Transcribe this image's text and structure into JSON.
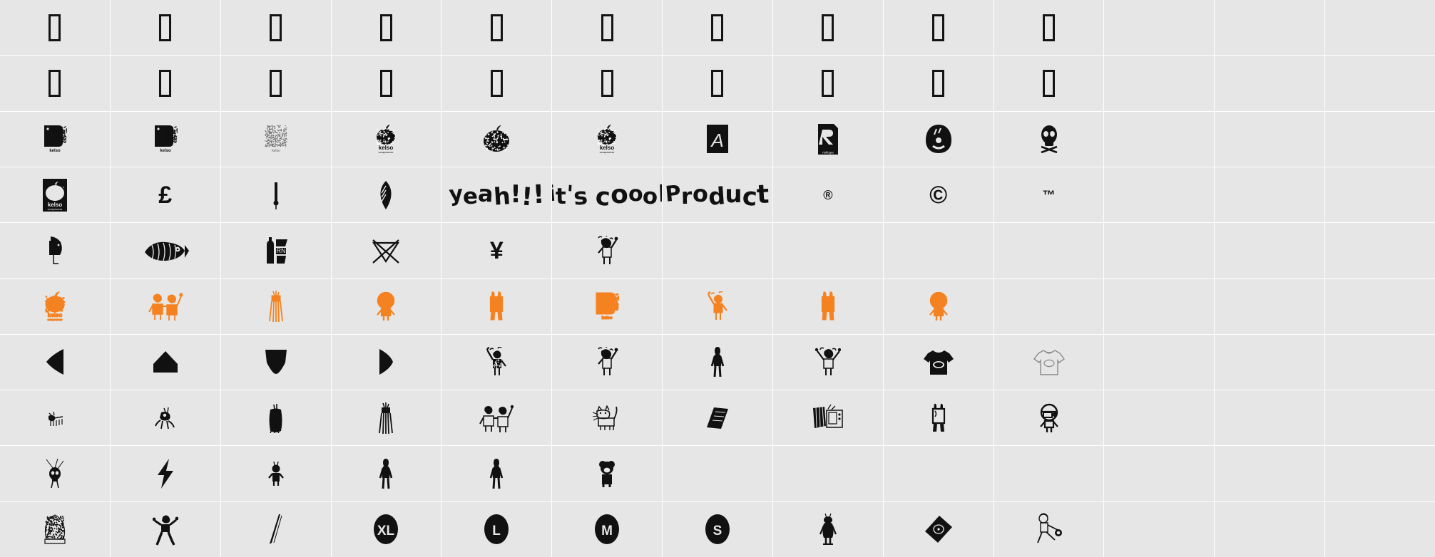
{
  "view": {
    "type": "font-character-map",
    "background_color": "#e6e6e6",
    "gridline_color": "#ffffff",
    "ink_color": "#111111",
    "accent_color": "#F58220",
    "columns": 13,
    "rows": 10
  },
  "cells": [
    {
      "r": 1,
      "c": 1,
      "name": "notdef-box",
      "kind": "notdef",
      "label": ""
    },
    {
      "r": 1,
      "c": 2,
      "name": "notdef-box",
      "kind": "notdef",
      "label": ""
    },
    {
      "r": 1,
      "c": 3,
      "name": "notdef-box",
      "kind": "notdef",
      "label": ""
    },
    {
      "r": 1,
      "c": 4,
      "name": "notdef-box",
      "kind": "notdef",
      "label": ""
    },
    {
      "r": 1,
      "c": 5,
      "name": "notdef-box",
      "kind": "notdef",
      "label": ""
    },
    {
      "r": 1,
      "c": 6,
      "name": "notdef-box",
      "kind": "notdef",
      "label": ""
    },
    {
      "r": 1,
      "c": 7,
      "name": "notdef-box",
      "kind": "notdef",
      "label": ""
    },
    {
      "r": 1,
      "c": 8,
      "name": "notdef-box",
      "kind": "notdef",
      "label": ""
    },
    {
      "r": 1,
      "c": 9,
      "name": "notdef-box",
      "kind": "notdef",
      "label": ""
    },
    {
      "r": 1,
      "c": 10,
      "name": "notdef-box",
      "kind": "notdef",
      "label": ""
    },
    {
      "r": 1,
      "c": 11,
      "name": "empty-cell",
      "kind": "empty",
      "label": ""
    },
    {
      "r": 1,
      "c": 12,
      "name": "empty-cell",
      "kind": "empty",
      "label": ""
    },
    {
      "r": 1,
      "c": 13,
      "name": "empty-cell",
      "kind": "empty",
      "label": ""
    },
    {
      "r": 2,
      "c": 1,
      "name": "notdef-box",
      "kind": "notdef",
      "label": ""
    },
    {
      "r": 2,
      "c": 2,
      "name": "notdef-box",
      "kind": "notdef",
      "label": ""
    },
    {
      "r": 2,
      "c": 3,
      "name": "notdef-box",
      "kind": "notdef",
      "label": ""
    },
    {
      "r": 2,
      "c": 4,
      "name": "notdef-box",
      "kind": "notdef",
      "label": ""
    },
    {
      "r": 2,
      "c": 5,
      "name": "notdef-box",
      "kind": "notdef",
      "label": ""
    },
    {
      "r": 2,
      "c": 6,
      "name": "notdef-box",
      "kind": "notdef",
      "label": ""
    },
    {
      "r": 2,
      "c": 7,
      "name": "notdef-box",
      "kind": "notdef",
      "label": ""
    },
    {
      "r": 2,
      "c": 8,
      "name": "notdef-box",
      "kind": "notdef",
      "label": ""
    },
    {
      "r": 2,
      "c": 9,
      "name": "notdef-box",
      "kind": "notdef",
      "label": ""
    },
    {
      "r": 2,
      "c": 10,
      "name": "notdef-box",
      "kind": "notdef",
      "label": ""
    },
    {
      "r": 2,
      "c": 11,
      "name": "empty-cell",
      "kind": "empty",
      "label": ""
    },
    {
      "r": 2,
      "c": 12,
      "name": "empty-cell",
      "kind": "empty",
      "label": ""
    },
    {
      "r": 2,
      "c": 13,
      "name": "empty-cell",
      "kind": "empty",
      "label": ""
    },
    {
      "r": 3,
      "c": 1,
      "name": "kelso-tag-logo-glyph",
      "kind": "kelso_tag",
      "label": "kelso"
    },
    {
      "r": 3,
      "c": 2,
      "name": "kelso-tag-logo-glyph",
      "kind": "kelso_tag",
      "label": "kelso"
    },
    {
      "r": 3,
      "c": 3,
      "name": "kelso-tag-outline-glyph",
      "kind": "kelso_tag_light",
      "label": "kelso"
    },
    {
      "r": 3,
      "c": 4,
      "name": "apple-wordmark-glyph",
      "kind": "apple_word",
      "label": "kelso"
    },
    {
      "r": 3,
      "c": 5,
      "name": "apple-solid-glyph",
      "kind": "apple_solid",
      "label": ""
    },
    {
      "r": 3,
      "c": 6,
      "name": "apple-wordmark-glyph",
      "kind": "apple_word",
      "label": "kelso"
    },
    {
      "r": 3,
      "c": 7,
      "name": "letter-a-box-glyph",
      "kind": "a_box",
      "label": "A"
    },
    {
      "r": 3,
      "c": 8,
      "name": "risktype-r-logo-glyph",
      "kind": "r_box",
      "label": "risktype"
    },
    {
      "r": 3,
      "c": 9,
      "name": "blob-face-glyph",
      "kind": "blob_face",
      "label": ""
    },
    {
      "r": 3,
      "c": 10,
      "name": "skull-crossbones-glyph",
      "kind": "skull",
      "label": ""
    },
    {
      "r": 3,
      "c": 11,
      "name": "empty-cell",
      "kind": "empty",
      "label": ""
    },
    {
      "r": 3,
      "c": 12,
      "name": "empty-cell",
      "kind": "empty",
      "label": ""
    },
    {
      "r": 3,
      "c": 13,
      "name": "empty-cell",
      "kind": "empty",
      "label": ""
    },
    {
      "r": 4,
      "c": 1,
      "name": "apple-label-box-glyph",
      "kind": "apple_label_box",
      "label": "kelso"
    },
    {
      "r": 4,
      "c": 2,
      "name": "pound-sign-glyph",
      "kind": "text_glyph",
      "label": "£"
    },
    {
      "r": 4,
      "c": 3,
      "name": "thin-figure-glyph",
      "kind": "thin_fig",
      "label": ""
    },
    {
      "r": 4,
      "c": 4,
      "name": "leaf-shell-glyph",
      "kind": "leaf",
      "label": ""
    },
    {
      "r": 4,
      "c": 5,
      "name": "yeah-lettering-glyph",
      "kind": "hand_text",
      "label": "yeah!!!"
    },
    {
      "r": 4,
      "c": 6,
      "name": "its-coool-lettering-glyph",
      "kind": "hand_text",
      "label": "it's coool"
    },
    {
      "r": 4,
      "c": 7,
      "name": "product-lettering-glyph",
      "kind": "hand_text",
      "label": "Product"
    },
    {
      "r": 4,
      "c": 8,
      "name": "registered-sign-glyph",
      "kind": "text_glyph_sm",
      "label": "®"
    },
    {
      "r": 4,
      "c": 9,
      "name": "copyright-sign-glyph",
      "kind": "text_glyph",
      "label": "©"
    },
    {
      "r": 4,
      "c": 10,
      "name": "trademark-sign-glyph",
      "kind": "text_glyph_sm",
      "label": "™"
    },
    {
      "r": 4,
      "c": 11,
      "name": "empty-cell",
      "kind": "empty",
      "label": ""
    },
    {
      "r": 4,
      "c": 12,
      "name": "empty-cell",
      "kind": "empty",
      "label": ""
    },
    {
      "r": 4,
      "c": 13,
      "name": "empty-cell",
      "kind": "empty",
      "label": ""
    },
    {
      "r": 5,
      "c": 1,
      "name": "bird-figure-glyph",
      "kind": "bird",
      "label": ""
    },
    {
      "r": 5,
      "c": 2,
      "name": "fish-glyph",
      "kind": "fish",
      "label": ""
    },
    {
      "r": 5,
      "c": 3,
      "name": "bottle-born-glyph",
      "kind": "born",
      "label": ""
    },
    {
      "r": 5,
      "c": 4,
      "name": "no-bleach-symbol-glyph",
      "kind": "nobleach",
      "label": ""
    },
    {
      "r": 5,
      "c": 5,
      "name": "yen-sign-glyph",
      "kind": "text_glyph",
      "label": "¥"
    },
    {
      "r": 5,
      "c": 6,
      "name": "cheering-person-glyph",
      "kind": "cheer",
      "label": ""
    },
    {
      "r": 5,
      "c": 7,
      "name": "empty-cell",
      "kind": "empty",
      "label": ""
    },
    {
      "r": 5,
      "c": 8,
      "name": "empty-cell",
      "kind": "empty",
      "label": ""
    },
    {
      "r": 5,
      "c": 9,
      "name": "empty-cell",
      "kind": "empty",
      "label": ""
    },
    {
      "r": 5,
      "c": 10,
      "name": "empty-cell",
      "kind": "empty",
      "label": ""
    },
    {
      "r": 5,
      "c": 11,
      "name": "empty-cell",
      "kind": "empty",
      "label": ""
    },
    {
      "r": 5,
      "c": 12,
      "name": "empty-cell",
      "kind": "empty",
      "label": ""
    },
    {
      "r": 5,
      "c": 13,
      "name": "empty-cell",
      "kind": "empty",
      "label": ""
    },
    {
      "r": 6,
      "c": 1,
      "name": "apple-wordmark-glyph-orange",
      "kind": "apple_word",
      "label": "kelso",
      "color": "#F58220"
    },
    {
      "r": 6,
      "c": 2,
      "name": "two-people-glyph-orange",
      "kind": "two_people",
      "label": "",
      "color": "#F58220"
    },
    {
      "r": 6,
      "c": 3,
      "name": "tassel-glyph-orange",
      "kind": "tassel",
      "label": "",
      "color": "#F58220"
    },
    {
      "r": 6,
      "c": 4,
      "name": "helmet-person-glyph-orange",
      "kind": "helmet_person",
      "label": "",
      "color": "#F58220"
    },
    {
      "r": 6,
      "c": 5,
      "name": "bunny-bag-glyph-orange",
      "kind": "bunny_bag",
      "label": "",
      "color": "#F58220"
    },
    {
      "r": 6,
      "c": 6,
      "name": "kelso-tag-logo-glyph-orange",
      "kind": "kelso_tag",
      "label": "kelso",
      "color": "#F58220"
    },
    {
      "r": 6,
      "c": 7,
      "name": "arm-raise-person-glyph-orange",
      "kind": "arm_raise",
      "label": "",
      "color": "#F58220"
    },
    {
      "r": 6,
      "c": 8,
      "name": "bunny-bag-glyph-orange",
      "kind": "bunny_bag",
      "label": "",
      "color": "#F58220"
    },
    {
      "r": 6,
      "c": 9,
      "name": "helmet-person-glyph-orange",
      "kind": "helmet_person",
      "label": "",
      "color": "#F58220"
    },
    {
      "r": 6,
      "c": 10,
      "name": "empty-cell",
      "kind": "empty",
      "label": ""
    },
    {
      "r": 6,
      "c": 11,
      "name": "empty-cell",
      "kind": "empty",
      "label": ""
    },
    {
      "r": 6,
      "c": 12,
      "name": "empty-cell",
      "kind": "empty",
      "label": ""
    },
    {
      "r": 6,
      "c": 13,
      "name": "empty-cell",
      "kind": "empty",
      "label": ""
    },
    {
      "r": 7,
      "c": 1,
      "name": "triangle-left-glyph",
      "kind": "tri_left",
      "label": ""
    },
    {
      "r": 7,
      "c": 2,
      "name": "triangle-up-glyph",
      "kind": "tri_up",
      "label": ""
    },
    {
      "r": 7,
      "c": 3,
      "name": "triangle-down-glyph",
      "kind": "tri_down",
      "label": ""
    },
    {
      "r": 7,
      "c": 4,
      "name": "triangle-right-glyph",
      "kind": "tri_right",
      "label": ""
    },
    {
      "r": 7,
      "c": 5,
      "name": "arm-raise-person-glyph",
      "kind": "arm_raise",
      "label": ""
    },
    {
      "r": 7,
      "c": 6,
      "name": "cheering-person-glyph",
      "kind": "cheer",
      "label": ""
    },
    {
      "r": 7,
      "c": 7,
      "name": "standing-person-glyph",
      "kind": "stand_person",
      "label": ""
    },
    {
      "r": 7,
      "c": 8,
      "name": "arms-up-person-glyph",
      "kind": "arms_up",
      "label": ""
    },
    {
      "r": 7,
      "c": 9,
      "name": "tshirt-black-glyph",
      "kind": "tshirt_black",
      "label": ""
    },
    {
      "r": 7,
      "c": 10,
      "name": "tshirt-outline-glyph",
      "kind": "tshirt_outline",
      "label": ""
    },
    {
      "r": 7,
      "c": 11,
      "name": "empty-cell",
      "kind": "empty",
      "label": ""
    },
    {
      "r": 7,
      "c": 12,
      "name": "empty-cell",
      "kind": "empty",
      "label": ""
    },
    {
      "r": 7,
      "c": 13,
      "name": "empty-cell",
      "kind": "empty",
      "label": ""
    },
    {
      "r": 8,
      "c": 1,
      "name": "small-insect-glyph",
      "kind": "insect",
      "label": ""
    },
    {
      "r": 8,
      "c": 2,
      "name": "small-creature-glyph",
      "kind": "creature",
      "label": ""
    },
    {
      "r": 8,
      "c": 3,
      "name": "tassel-glyph",
      "kind": "tassel_solid",
      "label": ""
    },
    {
      "r": 8,
      "c": 4,
      "name": "tassel-glyph",
      "kind": "tassel",
      "label": ""
    },
    {
      "r": 8,
      "c": 5,
      "name": "two-people-glyph",
      "kind": "two_people",
      "label": ""
    },
    {
      "r": 8,
      "c": 6,
      "name": "cat-glyph",
      "kind": "cat",
      "label": ""
    },
    {
      "r": 8,
      "c": 7,
      "name": "dark-parallelogram-glyph",
      "kind": "parallelogram",
      "label": ""
    },
    {
      "r": 8,
      "c": 8,
      "name": "tv-set-glyph",
      "kind": "tv",
      "label": ""
    },
    {
      "r": 8,
      "c": 9,
      "name": "bunny-bag-glyph",
      "kind": "bunny_bag",
      "label": ""
    },
    {
      "r": 8,
      "c": 10,
      "name": "helmet-person-glyph",
      "kind": "helmet_person",
      "label": ""
    },
    {
      "r": 8,
      "c": 11,
      "name": "empty-cell",
      "kind": "empty",
      "label": ""
    },
    {
      "r": 8,
      "c": 12,
      "name": "empty-cell",
      "kind": "empty",
      "label": ""
    },
    {
      "r": 8,
      "c": 13,
      "name": "empty-cell",
      "kind": "empty",
      "label": ""
    },
    {
      "r": 9,
      "c": 1,
      "name": "skull-spark-glyph",
      "kind": "skull_spark",
      "label": ""
    },
    {
      "r": 9,
      "c": 2,
      "name": "lightning-bolt-glyph",
      "kind": "bolt",
      "label": ""
    },
    {
      "r": 9,
      "c": 3,
      "name": "small-figure-glyph",
      "kind": "small_fig",
      "label": ""
    },
    {
      "r": 9,
      "c": 4,
      "name": "standing-person-glyph",
      "kind": "stand_person",
      "label": ""
    },
    {
      "r": 9,
      "c": 5,
      "name": "standing-person-glyph",
      "kind": "stand_person",
      "label": ""
    },
    {
      "r": 9,
      "c": 6,
      "name": "bear-figure-glyph",
      "kind": "bear",
      "label": ""
    },
    {
      "r": 9,
      "c": 7,
      "name": "empty-cell",
      "kind": "empty",
      "label": ""
    },
    {
      "r": 9,
      "c": 8,
      "name": "empty-cell",
      "kind": "empty",
      "label": ""
    },
    {
      "r": 9,
      "c": 9,
      "name": "empty-cell",
      "kind": "empty",
      "label": ""
    },
    {
      "r": 9,
      "c": 10,
      "name": "empty-cell",
      "kind": "empty",
      "label": ""
    },
    {
      "r": 9,
      "c": 11,
      "name": "empty-cell",
      "kind": "empty",
      "label": ""
    },
    {
      "r": 9,
      "c": 12,
      "name": "empty-cell",
      "kind": "empty",
      "label": ""
    },
    {
      "r": 9,
      "c": 13,
      "name": "empty-cell",
      "kind": "empty",
      "label": ""
    },
    {
      "r": 10,
      "c": 1,
      "name": "hedgehog-glyph",
      "kind": "hedgehog",
      "label": ""
    },
    {
      "r": 10,
      "c": 2,
      "name": "dancing-person-glyph",
      "kind": "dancer",
      "label": ""
    },
    {
      "r": 10,
      "c": 3,
      "name": "needle-glyph",
      "kind": "needle",
      "label": ""
    },
    {
      "r": 10,
      "c": 4,
      "name": "size-xl-badge-glyph",
      "kind": "size_badge",
      "label": "XL"
    },
    {
      "r": 10,
      "c": 5,
      "name": "size-l-badge-glyph",
      "kind": "size_badge",
      "label": "L"
    },
    {
      "r": 10,
      "c": 6,
      "name": "size-m-badge-glyph",
      "kind": "size_badge",
      "label": "M"
    },
    {
      "r": 10,
      "c": 7,
      "name": "size-s-badge-glyph",
      "kind": "size_badge",
      "label": "S"
    },
    {
      "r": 10,
      "c": 8,
      "name": "alien-figure-glyph",
      "kind": "alien",
      "label": ""
    },
    {
      "r": 10,
      "c": 9,
      "name": "diamond-record-glyph",
      "kind": "diamond",
      "label": ""
    },
    {
      "r": 10,
      "c": 10,
      "name": "kicking-person-glyph",
      "kind": "kicker",
      "label": ""
    },
    {
      "r": 10,
      "c": 11,
      "name": "empty-cell",
      "kind": "empty",
      "label": ""
    },
    {
      "r": 10,
      "c": 12,
      "name": "empty-cell",
      "kind": "empty",
      "label": ""
    },
    {
      "r": 10,
      "c": 13,
      "name": "empty-cell",
      "kind": "empty",
      "label": ""
    }
  ]
}
